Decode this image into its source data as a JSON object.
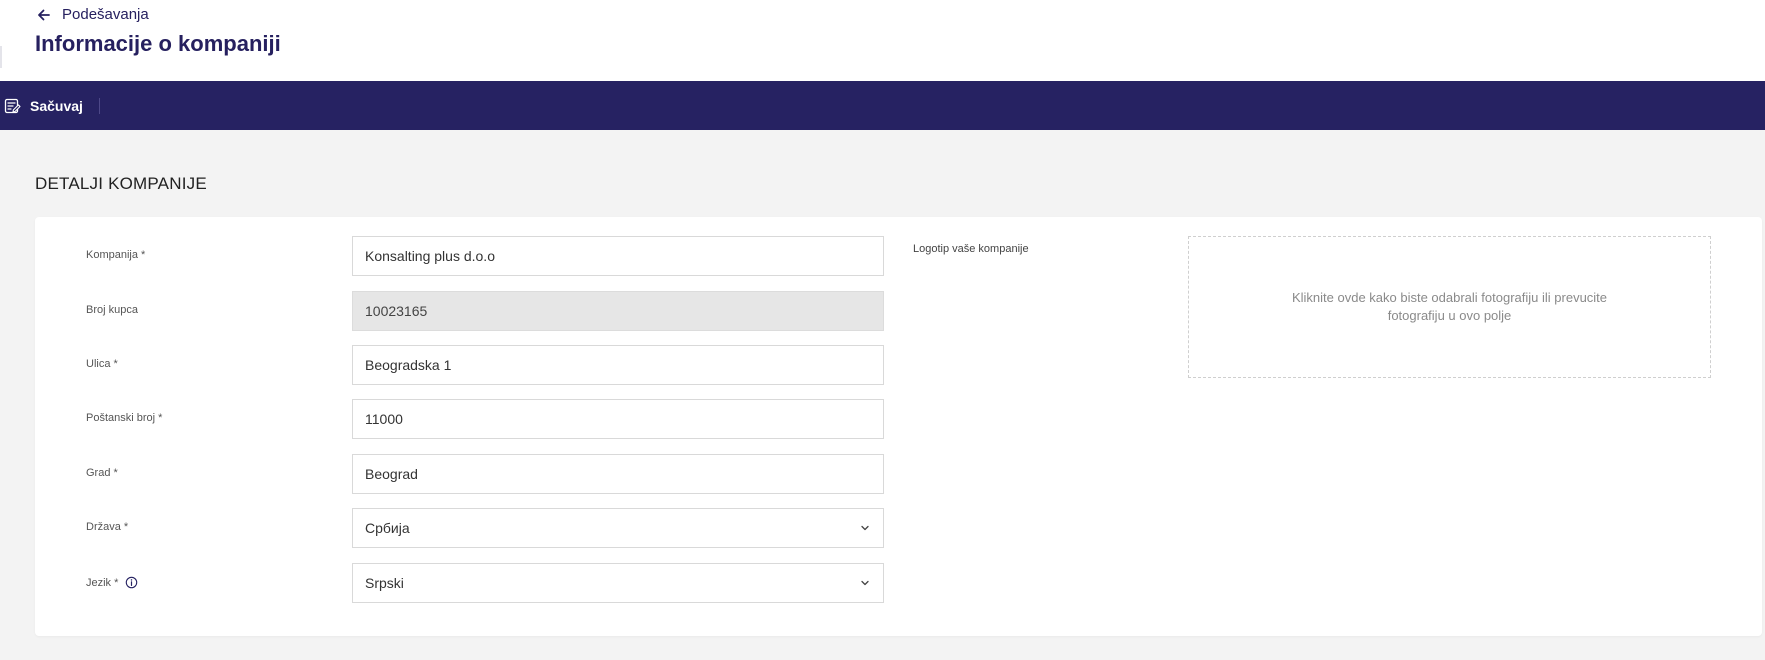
{
  "header": {
    "back_label": "Podešavanja",
    "title": "Informacije o kompaniji",
    "back_icon": "arrow-left-icon"
  },
  "toolbar": {
    "save_label": "Sačuvaj",
    "save_icon": "save-document-icon"
  },
  "section": {
    "title": "DETALJI KOMPANIJE"
  },
  "form": {
    "company": {
      "label": "Kompanija *",
      "value": "Konsalting plus d.o.o"
    },
    "customer_number": {
      "label": "Broj kupca",
      "value": "10023165"
    },
    "street": {
      "label": "Ulica *",
      "value": "Beogradska 1"
    },
    "postal_code": {
      "label": "Poštanski broj *",
      "value": "11000"
    },
    "city": {
      "label": "Grad *",
      "value": "Beograd"
    },
    "country": {
      "label": "Država *",
      "value": "Србија"
    },
    "language": {
      "label": "Jezik *",
      "value": "Srpski"
    }
  },
  "logo": {
    "label": "Logotip vaše kompanije",
    "dropzone_text": "Kliknite ovde kako biste odabrali fotografiju ili prevucite fotografiju u ovo polje"
  },
  "colors": {
    "primary": "#262262",
    "page_background": "#f3f3f3",
    "readonly_background": "#e6e6e6"
  }
}
